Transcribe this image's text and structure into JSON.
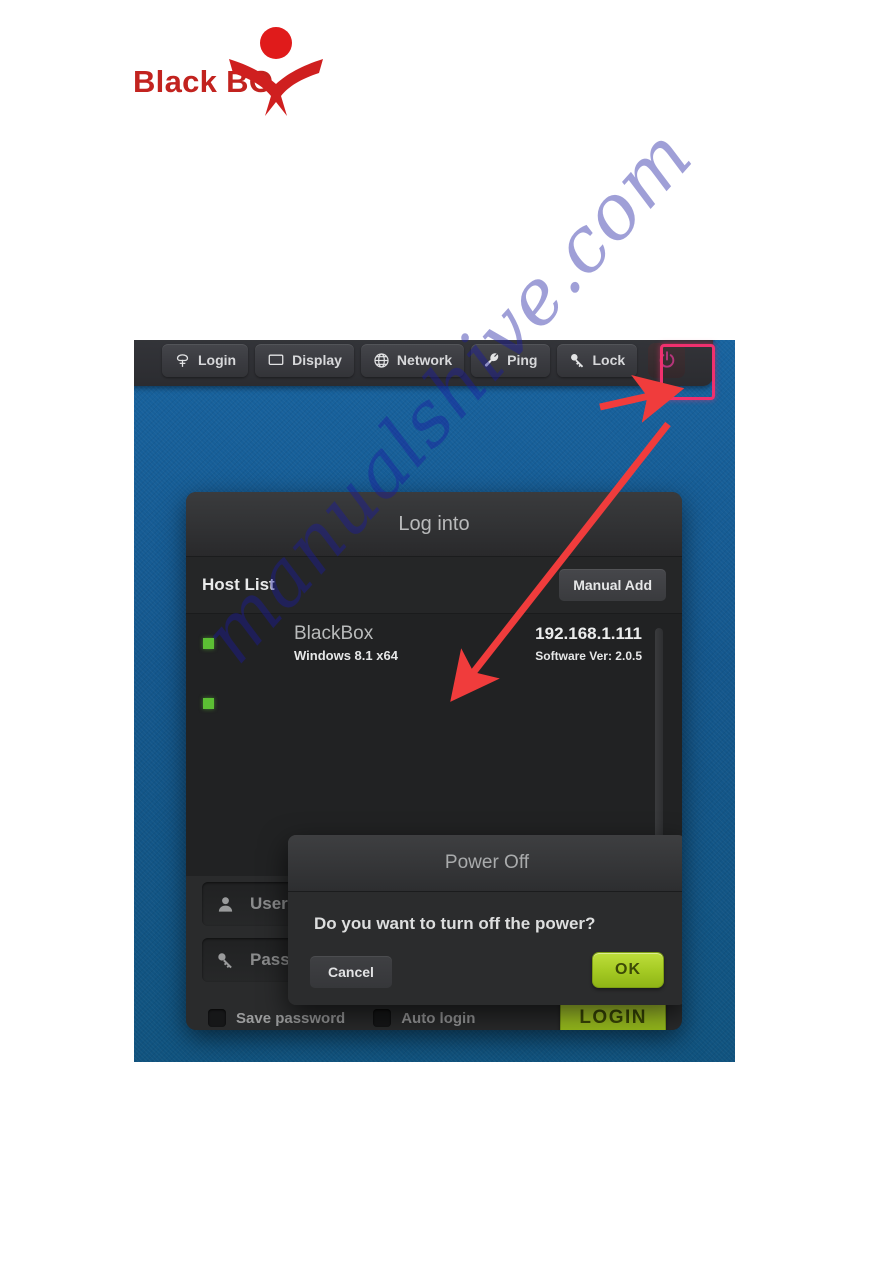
{
  "brand": {
    "text": "Black BO",
    "color": "#c2231f",
    "mark_icon": "starman-logo-icon"
  },
  "watermark": {
    "text": "manualshive.com",
    "color": "#1a1aa0"
  },
  "toolbar": {
    "buttons": [
      {
        "label": "Login",
        "icon": "login-icon"
      },
      {
        "label": "Display",
        "icon": "monitor-icon"
      },
      {
        "label": "Network",
        "icon": "globe-icon"
      },
      {
        "label": "Ping",
        "icon": "wrench-icon"
      },
      {
        "label": "Lock",
        "icon": "key-icon"
      }
    ],
    "power": {
      "icon": "power-icon",
      "highlight_color": "#f0306e"
    }
  },
  "login_window": {
    "title": "Log into",
    "host_list_label": "Host List",
    "manual_add_label": "Manual Add",
    "hosts": [
      {
        "name": "BlackBox",
        "os": "Windows 8.1 x64",
        "ip": "192.168.1.111",
        "version": "Software Ver: 2.0.5",
        "status_color": "#5cbf34"
      },
      {
        "name": "",
        "os": "",
        "ip": "",
        "version": "",
        "status_color": "#5cbf34"
      }
    ],
    "username": {
      "placeholder": "Username",
      "value": "",
      "icon": "user-icon"
    },
    "password": {
      "placeholder": "Password",
      "value": "",
      "icon": "key-icon"
    },
    "options": [
      {
        "label": "Save password",
        "checked": false
      },
      {
        "label": "Auto login",
        "checked": false
      }
    ],
    "login_button": "LOGIN"
  },
  "modal": {
    "title": "Power Off",
    "message": "Do you want to turn off the power?",
    "cancel_label": "Cancel",
    "ok_label": "OK",
    "ok_color": "#a6cb24"
  },
  "annotations": {
    "arrow_color": "#f03c3c",
    "arrows": [
      {
        "name": "arrow-to-power-button"
      },
      {
        "name": "arrow-to-power-off-dialog"
      }
    ]
  }
}
